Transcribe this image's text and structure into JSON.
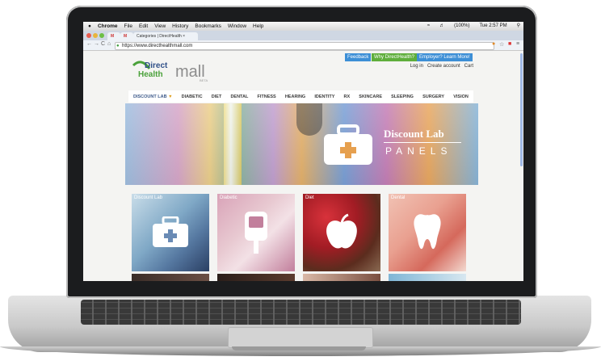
{
  "menubar": {
    "app": "Chrome",
    "items": [
      "File",
      "Edit",
      "View",
      "History",
      "Bookmarks",
      "Window",
      "Help"
    ],
    "battery": "(100%)",
    "clock": "Tue 2:57 PM"
  },
  "tabs": [
    {
      "label": "M"
    },
    {
      "label": "Categories | DirectHealth"
    }
  ],
  "address": {
    "url": "https://www.directhealthmall.com"
  },
  "site": {
    "logo_top": "Direct",
    "logo_bottom": "Health",
    "logo_mall": "mall",
    "logo_beta": "BETA",
    "feedback": "Feedback",
    "why": "Why DirectHealth?",
    "employer": "Employer? Learn More!",
    "login": "Log in",
    "create": "Create account",
    "cart": "Cart"
  },
  "nav": [
    "DISCOUNT LAB",
    "DIABETIC",
    "DIET",
    "DENTAL",
    "FITNESS",
    "HEARING",
    "IDENTITY",
    "RX",
    "SKINCARE",
    "SLEEPING",
    "SURGERY",
    "VISION"
  ],
  "hero": {
    "title": "Discount Lab",
    "subtitle": "PANELS"
  },
  "tiles": [
    {
      "label": "Discount Lab",
      "icon": "medical-kit-icon"
    },
    {
      "label": "Diabetic",
      "icon": "glucose-meter-icon"
    },
    {
      "label": "Diet",
      "icon": "apple-icon"
    },
    {
      "label": "Dental",
      "icon": "tooth-icon"
    }
  ],
  "colors": {
    "feedback": "#3d8fd6",
    "why": "#5fae3c",
    "employer": "#3d8fd6",
    "logo_green": "#4aa13a",
    "logo_blue": "#2f4f88"
  }
}
